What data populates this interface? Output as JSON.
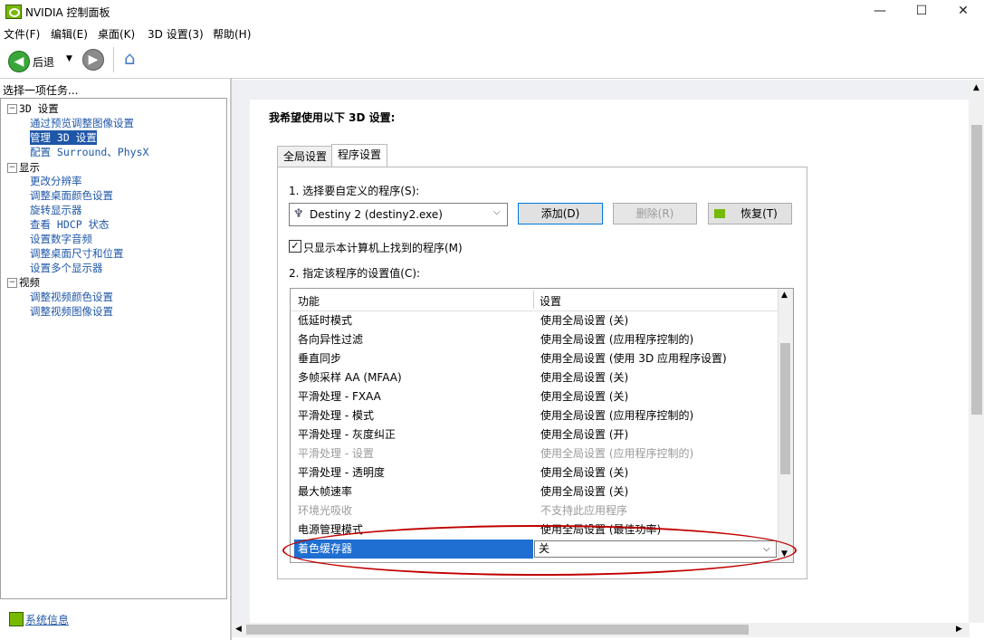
{
  "window": {
    "title": "NVIDIA 控制面板",
    "minimize": "—",
    "maximize": "☐",
    "close": "✕"
  },
  "menu": [
    "文件(F)",
    "编辑(E)",
    "桌面(K)",
    "3D 设置(3)",
    "帮助(H)"
  ],
  "toolbar": {
    "back_label": "后退"
  },
  "left": {
    "task_label": "选择一项任务...",
    "tree": [
      {
        "type": "group",
        "label": "3D 设置"
      },
      {
        "type": "link",
        "label": "通过预览调整图像设置"
      },
      {
        "type": "link",
        "label": "管理 3D 设置",
        "selected": true
      },
      {
        "type": "link",
        "label": "配置 Surround、PhysX"
      },
      {
        "type": "group",
        "label": "显示"
      },
      {
        "type": "link",
        "label": "更改分辨率"
      },
      {
        "type": "link",
        "label": "调整桌面颜色设置"
      },
      {
        "type": "link",
        "label": "旋转显示器"
      },
      {
        "type": "link",
        "label": "查看 HDCP 状态"
      },
      {
        "type": "link",
        "label": "设置数字音频"
      },
      {
        "type": "link",
        "label": "调整桌面尺寸和位置"
      },
      {
        "type": "link",
        "label": "设置多个显示器"
      },
      {
        "type": "group",
        "label": "视频"
      },
      {
        "type": "link",
        "label": "调整视频颜色设置"
      },
      {
        "type": "link",
        "label": "调整视频图像设置"
      }
    ],
    "sysinfo": "系统信息"
  },
  "main": {
    "heading": "我希望使用以下 3D 设置:",
    "tabs": [
      {
        "label": "全局设置",
        "active": false
      },
      {
        "label": "程序设置",
        "active": true
      }
    ],
    "step1": "1. 选择要自定义的程序(S):",
    "program": "Destiny 2 (destiny2.exe)",
    "add_btn": "添加(D)",
    "remove_btn": "删除(R)",
    "restore_btn": "恢复(T)",
    "only_found_checkbox": "只显示本计算机上找到的程序(M)",
    "only_found_checked": true,
    "step2": "2. 指定该程序的设置值(C):",
    "grid": {
      "col_feature": "功能",
      "col_setting": "设置",
      "rows": [
        {
          "feature": "低延时模式",
          "setting": "使用全局设置 (关)",
          "dim": false
        },
        {
          "feature": "各向异性过滤",
          "setting": "使用全局设置 (应用程序控制的)",
          "dim": false
        },
        {
          "feature": "垂直同步",
          "setting": "使用全局设置 (使用 3D 应用程序设置)",
          "dim": false
        },
        {
          "feature": "多帧采样 AA (MFAA)",
          "setting": "使用全局设置 (关)",
          "dim": false
        },
        {
          "feature": "平滑处理 - FXAA",
          "setting": "使用全局设置 (关)",
          "dim": false
        },
        {
          "feature": "平滑处理 - 模式",
          "setting": "使用全局设置 (应用程序控制的)",
          "dim": false
        },
        {
          "feature": "平滑处理 - 灰度纠正",
          "setting": "使用全局设置 (开)",
          "dim": false
        },
        {
          "feature": "平滑处理 - 设置",
          "setting": "使用全局设置 (应用程序控制的)",
          "dim": true
        },
        {
          "feature": "平滑处理 - 透明度",
          "setting": "使用全局设置 (关)",
          "dim": false
        },
        {
          "feature": "最大帧速率",
          "setting": "使用全局设置 (关)",
          "dim": false
        },
        {
          "feature": "环境光吸收",
          "setting": "不支持此应用程序",
          "dim": true
        },
        {
          "feature": "电源管理模式",
          "setting": "使用全局设置 (最佳功率)",
          "dim": false
        }
      ],
      "selected_row": {
        "feature": "着色缓存器",
        "setting": "关"
      }
    }
  },
  "colors": {
    "nvidia_green": "#76b900",
    "link_blue": "#1f57a8",
    "selection_blue": "#1f6fd2",
    "annotation_red": "#c00000"
  }
}
